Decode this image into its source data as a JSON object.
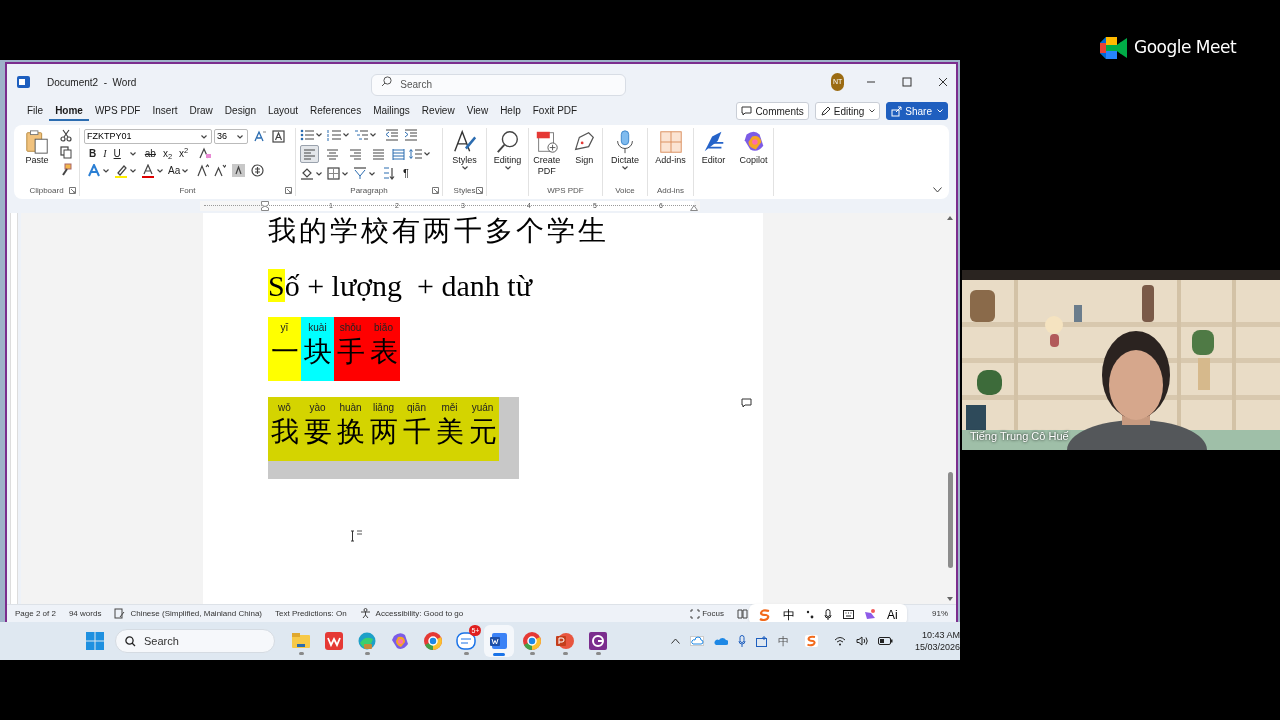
{
  "meet": {
    "brand": "Google Meet"
  },
  "word": {
    "title": "Document2  -  Word",
    "search": {
      "placeholder": "Search"
    },
    "avatar": "NT",
    "tabs": [
      {
        "label": "File",
        "selected": false
      },
      {
        "label": "Home",
        "selected": true
      },
      {
        "label": "WPS PDF",
        "selected": false
      },
      {
        "label": "Insert",
        "selected": false
      },
      {
        "label": "Draw",
        "selected": false
      },
      {
        "label": "Design",
        "selected": false
      },
      {
        "label": "Layout",
        "selected": false
      },
      {
        "label": "References",
        "selected": false
      },
      {
        "label": "Mailings",
        "selected": false
      },
      {
        "label": "Review",
        "selected": false
      },
      {
        "label": "View",
        "selected": false
      },
      {
        "label": "Help",
        "selected": false
      },
      {
        "label": "Foxit PDF",
        "selected": false
      }
    ],
    "actions": [
      {
        "label": "Comments",
        "kind": "comments"
      },
      {
        "label": "Editing",
        "kind": "mode"
      },
      {
        "label": "Share",
        "kind": "share"
      }
    ],
    "ribbon": {
      "groups": [
        {
          "kind": "clipboard",
          "label": "Clipboard",
          "buttons": [
            {
              "label": "Paste",
              "kind": "paste"
            }
          ]
        },
        {
          "kind": "font",
          "label": "Font",
          "font": "FZKTPY01",
          "size": "36",
          "format": [
            {
              "text": "B",
              "kind": "bold"
            },
            {
              "text": "I",
              "kind": "italic"
            },
            {
              "text": "U",
              "kind": "underline"
            },
            {
              "text": "ab",
              "kind": "strike"
            },
            {
              "text": "x$_{2}$",
              "kind": "plain"
            },
            {
              "text": "x$^{2}$",
              "kind": "plain"
            }
          ],
          "case": "Aa"
        },
        {
          "kind": "paragraph",
          "label": "Paragraph",
          "align": [
            {
              "selected": true
            },
            {
              "selected": false
            },
            {
              "selected": false
            },
            {
              "selected": false
            }
          ],
          "marks": "¶"
        },
        {
          "kind": "buttons",
          "label": "Styles",
          "buttons": [
            {
              "label": "Styles",
              "kind": "styles"
            }
          ]
        },
        {
          "kind": "buttons",
          "buttons": [
            {
              "label": "Editing",
              "kind": "find"
            }
          ]
        },
        {
          "kind": "buttons",
          "label": "WPS PDF",
          "buttons": [
            {
              "label": "Create PDF",
              "kind": "pdf"
            },
            {
              "label": "Sign",
              "kind": "sign"
            }
          ]
        },
        {
          "kind": "buttons",
          "label": "Voice",
          "buttons": [
            {
              "label": "Dictate",
              "kind": "mic"
            }
          ]
        },
        {
          "kind": "buttons",
          "label": "Add-ins",
          "buttons": [
            {
              "label": "Add-ins",
              "kind": "addins"
            }
          ]
        },
        {
          "kind": "buttons",
          "buttons": [
            {
              "label": "Editor",
              "kind": "editor"
            },
            {
              "label": "Copilot",
              "kind": "copilot"
            }
          ]
        }
      ]
    },
    "ruler": [
      "1",
      "2",
      "3",
      "4",
      "5",
      "6"
    ],
    "document": {
      "lines": [
        {
          "kind": "heading",
          "text": "我的学校有两千多个学生"
        },
        {
          "kind": "formula",
          "segments": [
            {
              "text": "S",
              "color": "#ffff00"
            },
            {
              "text": "ố + lượng  + danh từ"
            }
          ]
        },
        {
          "kind": "cells",
          "selected": false,
          "cells": [
            {
              "pinyin": "yī",
              "hanzi": "一",
              "color": "#ffff00"
            },
            {
              "pinyin": "kuài",
              "hanzi": "块",
              "color": "#00ffff"
            },
            {
              "pinyin": "shǒu",
              "hanzi": "手",
              "color": "#ff0000"
            },
            {
              "pinyin": "biǎo",
              "hanzi": "表",
              "color": "#ff0000"
            }
          ]
        },
        {
          "kind": "cells",
          "selected": true,
          "cells": [
            {
              "pinyin": "wǒ",
              "hanzi": "我",
              "color": "#d4d400"
            },
            {
              "pinyin": "yào",
              "hanzi": "要",
              "color": "#d4d400"
            },
            {
              "pinyin": "huàn",
              "hanzi": "换",
              "color": "#d4d400"
            },
            {
              "pinyin": "liǎng",
              "hanzi": "两",
              "color": "#d4d400"
            },
            {
              "pinyin": "qiān",
              "hanzi": "千",
              "color": "#d4d400"
            },
            {
              "pinyin": "měi",
              "hanzi": "美",
              "color": "#d4d400"
            },
            {
              "pinyin": "yuán",
              "hanzi": "元",
              "color": "#d4d400"
            }
          ]
        }
      ]
    },
    "status_bar": {
      "items": [
        {
          "text": "Page 2 of 2",
          "kind": "plain"
        },
        {
          "text": "94 words",
          "kind": "plain"
        },
        {
          "text": "Chinese (Simplified, Mainland China)",
          "kind": "language"
        },
        {
          "text": "Text Predictions: On",
          "kind": "plain"
        },
        {
          "text": "Accessibility: Good to go",
          "kind": "accessibility"
        }
      ],
      "focus": "Focus",
      "zoom": "91%"
    }
  },
  "ime": {
    "mode": "中",
    "ai": "Ai"
  },
  "taskbar": {
    "search": "Search",
    "apps": [
      {
        "kind": "files",
        "selected": false,
        "running": true
      },
      {
        "kind": "wps",
        "selected": false,
        "running": false
      },
      {
        "kind": "edge",
        "selected": false,
        "running": true
      },
      {
        "kind": "copilot",
        "selected": false,
        "running": false
      },
      {
        "kind": "chrome",
        "selected": false,
        "running": false
      },
      {
        "kind": "chat",
        "selected": false,
        "running": true,
        "badge": "5+"
      },
      {
        "kind": "word",
        "selected": true,
        "running": true
      },
      {
        "kind": "chrome",
        "selected": false,
        "running": true
      },
      {
        "kind": "ppt",
        "selected": false,
        "running": true
      },
      {
        "kind": "g",
        "selected": false,
        "running": true
      }
    ],
    "tray_ime": "中",
    "time": "10:43 AM",
    "date": "15/03/2026"
  },
  "video": {
    "name": "Tiếng Trung Cô Huế"
  }
}
